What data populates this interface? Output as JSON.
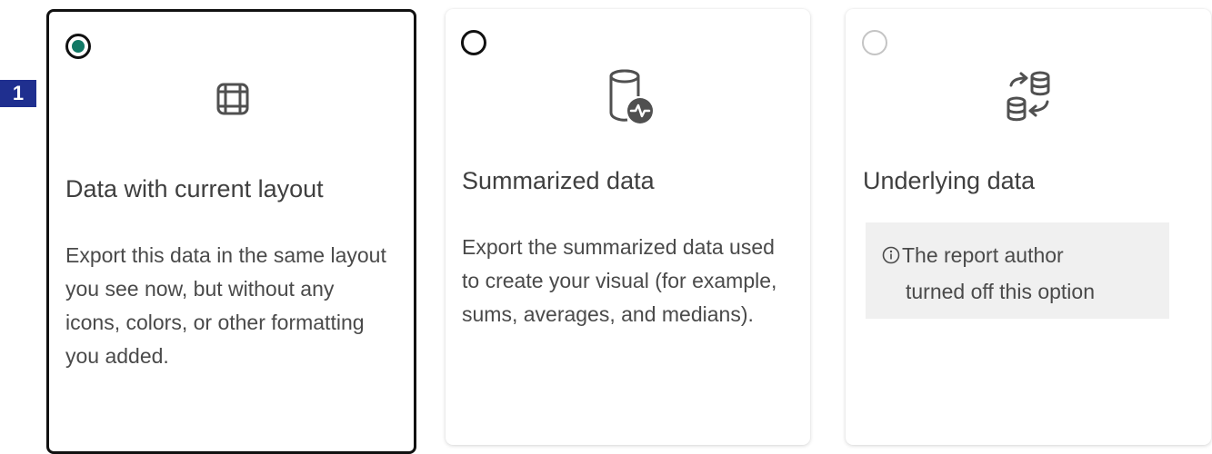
{
  "step_badge": "1",
  "options": [
    {
      "id": "data-with-current-layout",
      "selected": true,
      "enabled": true,
      "icon": "table-grid-icon",
      "title": "Data with current layout",
      "description": "Export this data in the same layout you see now, but without any icons, colors, or other formatting you added."
    },
    {
      "id": "summarized-data",
      "selected": false,
      "enabled": true,
      "icon": "database-pulse-icon",
      "title": "Summarized data",
      "description": "Export the summarized data used to create your visual (for example, sums, averages, and medians)."
    },
    {
      "id": "underlying-data",
      "selected": false,
      "enabled": false,
      "icon": "database-swap-icon",
      "title": "Underlying data",
      "info_icon": "info-icon",
      "info_line1": "The report author",
      "info_line2": "turned off this option"
    }
  ],
  "colors": {
    "selected_radio": "#117865",
    "badge": "#1f2f8f",
    "info_background": "#f0f0f0"
  }
}
